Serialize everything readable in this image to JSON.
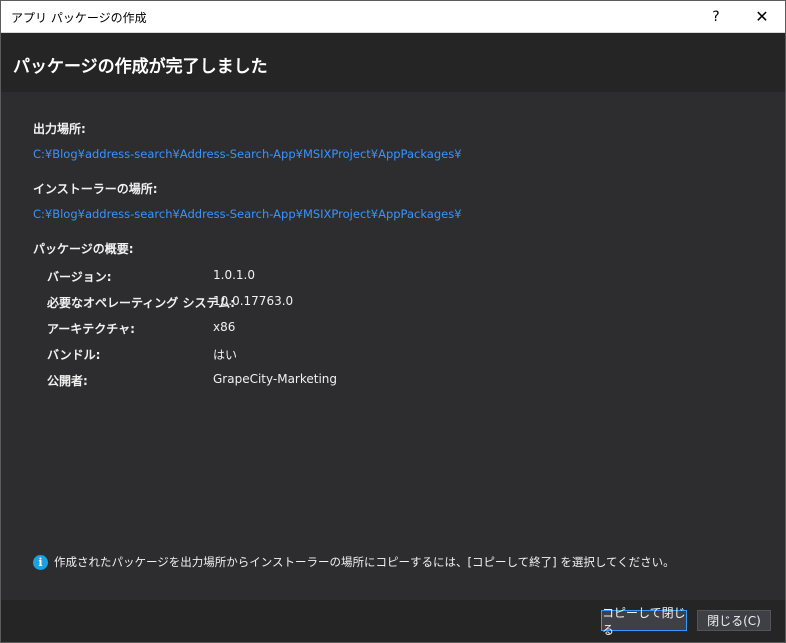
{
  "window": {
    "title": "アプリ パッケージの作成",
    "help_label": "?",
    "close_label": "✕"
  },
  "header": {
    "heading": "パッケージの作成が完了しました"
  },
  "output": {
    "label": "出力場所:",
    "path": "C:¥Blog¥address-search¥Address-Search-App¥MSIXProject¥AppPackages¥"
  },
  "installer": {
    "label": "インストーラーの場所:",
    "path": "C:¥Blog¥address-search¥Address-Search-App¥MSIXProject¥AppPackages¥"
  },
  "summary": {
    "label": "パッケージの概要:",
    "rows": [
      {
        "key": "バージョン:",
        "value": "1.0.1.0"
      },
      {
        "key": "必要なオペレーティング システム:",
        "value": "10.0.17763.0"
      },
      {
        "key": "アーキテクチャ:",
        "value": "x86"
      },
      {
        "key": "バンドル:",
        "value": "はい"
      },
      {
        "key": "公開者:",
        "value": "GrapeCity-Marketing"
      }
    ]
  },
  "info": {
    "icon": "info-icon",
    "glyph": "i",
    "text": "作成されたパッケージを出力場所からインストーラーの場所にコピーするには、[コピーして終了] を選択してください。"
  },
  "buttons": {
    "copy_close": "コピーして閉じる",
    "close": "閉じる(C)"
  }
}
